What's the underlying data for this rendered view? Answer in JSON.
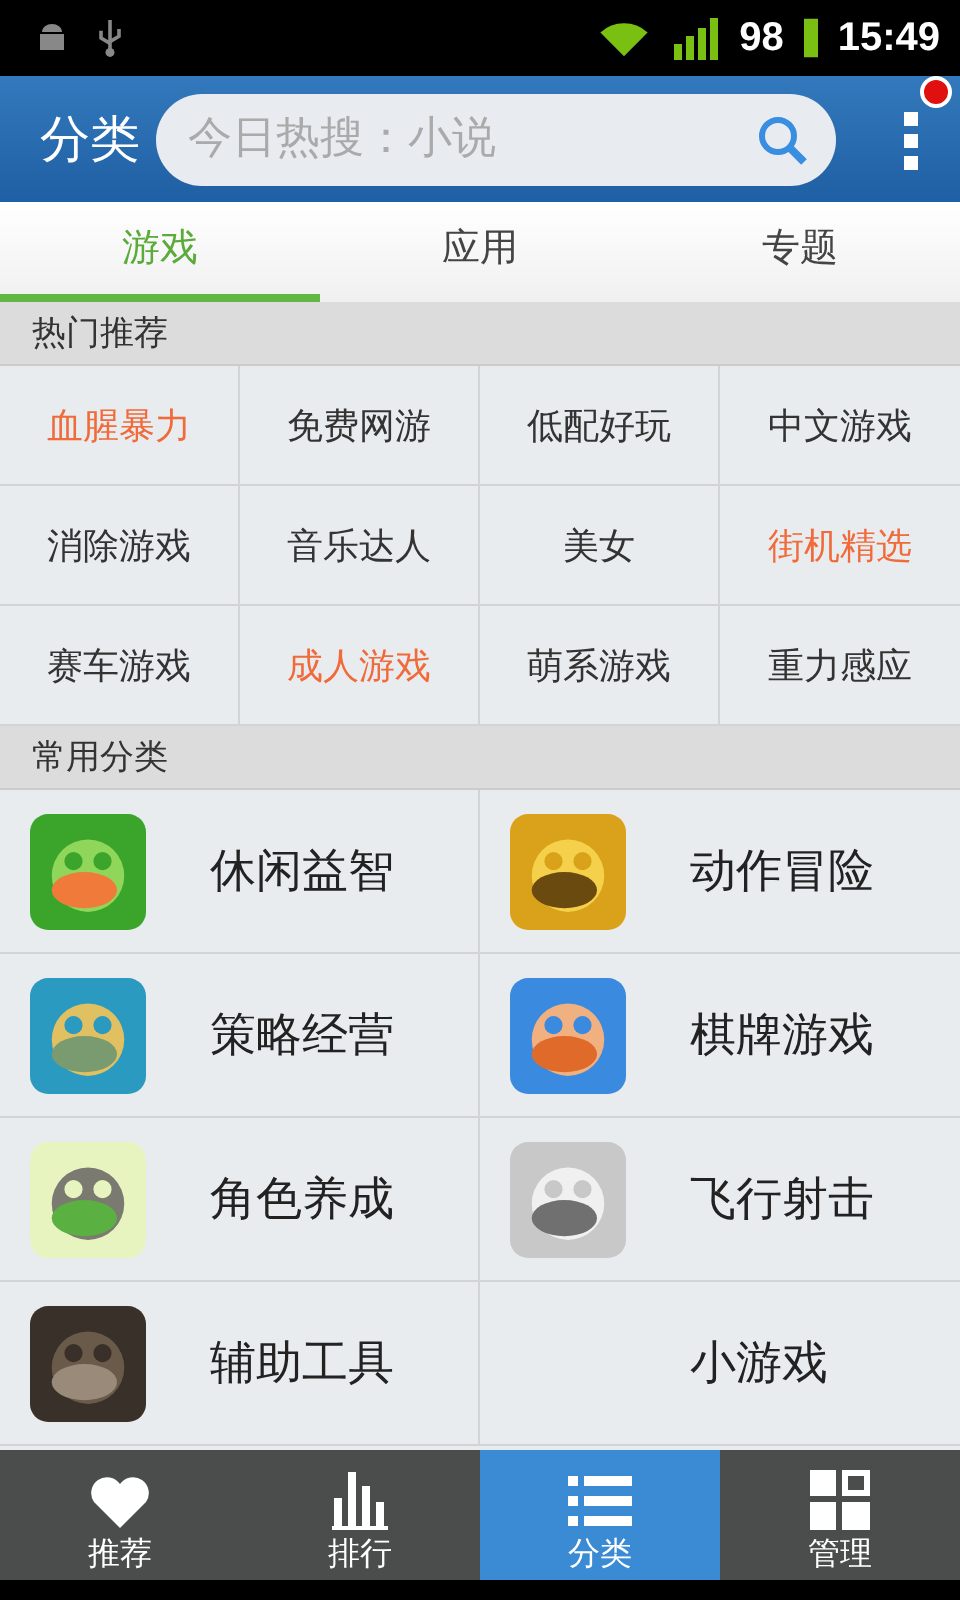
{
  "status_bar": {
    "battery": "98",
    "time": "15:49"
  },
  "header": {
    "title": "分类",
    "search": {
      "placeholder": "今日热搜：小说"
    },
    "menu_badge": true
  },
  "tabs": [
    {
      "label": "游戏",
      "selected": true
    },
    {
      "label": "应用",
      "selected": false
    },
    {
      "label": "专题",
      "selected": false
    }
  ],
  "hot": {
    "title": "热门推荐",
    "items": [
      {
        "label": "血腥暴力",
        "highlight": true
      },
      {
        "label": "免费网游",
        "highlight": false
      },
      {
        "label": "低配好玩",
        "highlight": false
      },
      {
        "label": "中文游戏",
        "highlight": false
      },
      {
        "label": "消除游戏",
        "highlight": false
      },
      {
        "label": "音乐达人",
        "highlight": false
      },
      {
        "label": "美女",
        "highlight": false
      },
      {
        "label": "街机精选",
        "highlight": true
      },
      {
        "label": "赛车游戏",
        "highlight": false
      },
      {
        "label": "成人游戏",
        "highlight": true
      },
      {
        "label": "萌系游戏",
        "highlight": false
      },
      {
        "label": "重力感应",
        "highlight": false
      }
    ]
  },
  "common": {
    "title": "常用分类",
    "items": [
      {
        "label": "休闲益智",
        "kind": "picture"
      },
      {
        "label": "动作冒险",
        "kind": "picture"
      },
      {
        "label": "策略经营",
        "kind": "picture"
      },
      {
        "label": "棋牌游戏",
        "kind": "picture"
      },
      {
        "label": "角色养成",
        "kind": "picture"
      },
      {
        "label": "飞行射击",
        "kind": "picture"
      },
      {
        "label": "辅助工具",
        "kind": "picture"
      },
      {
        "label": "小游戏"
      }
    ]
  },
  "bottom_nav": [
    {
      "label": "推荐",
      "selected": false
    },
    {
      "label": "排行",
      "selected": false
    },
    {
      "label": "分类",
      "selected": true
    },
    {
      "label": "管理",
      "selected": false
    }
  ]
}
